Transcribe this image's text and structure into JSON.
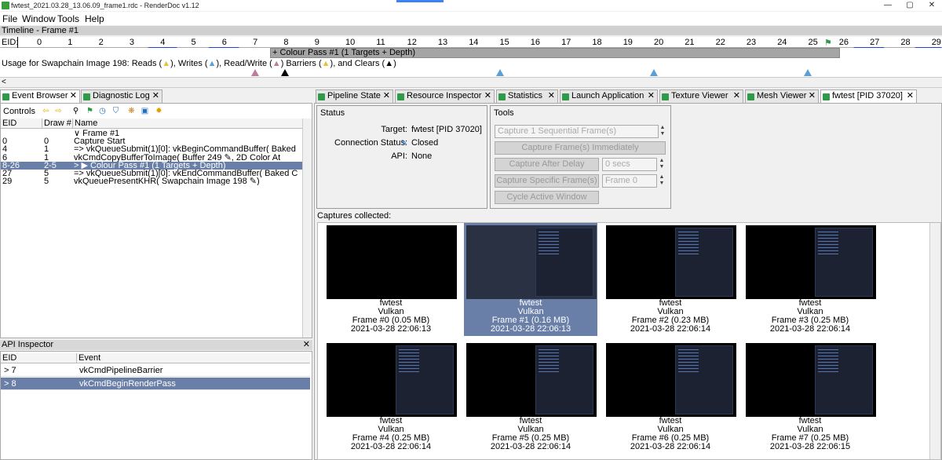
{
  "window": {
    "title": "fwtest_2021.03.28_13.06.09_frame1.rdc - RenderDoc v1.12",
    "minimize": "—",
    "maximize": "▢",
    "close": "✕"
  },
  "menu": [
    "File",
    "Window",
    "Tools",
    "Help"
  ],
  "timeline": {
    "title": "Timeline - Frame #1",
    "eid_label": "EID:",
    "ticks": [
      "0",
      "1",
      "2",
      "3",
      "4",
      "5",
      "6",
      "7",
      "8",
      "9",
      "10",
      "11",
      "12",
      "13",
      "14",
      "15",
      "16",
      "17",
      "18",
      "19",
      "20",
      "21",
      "22",
      "23",
      "24",
      "25",
      "26",
      "27",
      "28",
      "29"
    ],
    "pass_label": "+ Colour Pass #1 (1 Targets + Depth)",
    "usage_text_prefix": "Usage for Swapchain Image 198: Reads (",
    "usage_writes": "), Writes (",
    "usage_rw": "), Read/Write (",
    "usage_barriers": ") Barriers (",
    "usage_clears": "), and Clears (",
    "usage_end": ")",
    "scroll_left": "<"
  },
  "left_tabs": [
    {
      "label": "Event Browser",
      "active": true
    },
    {
      "label": "Diagnostic Log",
      "active": false
    }
  ],
  "right_tabs": [
    {
      "label": "Pipeline State",
      "active": false
    },
    {
      "label": "Resource Inspector",
      "active": false
    },
    {
      "label": "Statistics",
      "active": false
    },
    {
      "label": "Launch Application",
      "active": false
    },
    {
      "label": "Texture Viewer",
      "active": false
    },
    {
      "label": "Mesh Viewer",
      "active": false
    },
    {
      "label": "fwtest [PID 37020]",
      "active": true
    }
  ],
  "event_browser": {
    "controls_label": "Controls",
    "columns": [
      "EID",
      "Draw #",
      "Name"
    ],
    "rows": [
      {
        "eid": "",
        "draw": "",
        "name": "∨ Frame #1",
        "selected": false
      },
      {
        "eid": "0",
        "draw": "0",
        "name": "Capture Start",
        "selected": false
      },
      {
        "eid": "4",
        "draw": "1",
        "name": "=> vkQueueSubmit(1)[0]: vkBeginCommandBuffer( Baked",
        "selected": false
      },
      {
        "eid": "6",
        "draw": "1",
        "name": "vkCmdCopyBufferToImage( Buffer 249 ✎, 2D Color At",
        "selected": false
      },
      {
        "eid": "8-26",
        "draw": "2-5",
        "name": "> ▶ Colour Pass #1 (1 Targets + Depth)",
        "selected": true
      },
      {
        "eid": "27",
        "draw": "5",
        "name": "=> vkQueueSubmit(1)[0]: vkEndCommandBuffer( Baked C",
        "selected": false
      },
      {
        "eid": "29",
        "draw": "5",
        "name": "vkQueuePresentKHR( Swapchain Image 198 ✎)",
        "selected": false
      }
    ]
  },
  "api_inspector": {
    "title": "API Inspector",
    "close": "✕",
    "columns": [
      "EID",
      "Event"
    ],
    "rows": [
      {
        "eid": "> 7",
        "event": "vkCmdPipelineBarrier",
        "selected": false
      },
      {
        "eid": "> 8",
        "event": "vkCmdBeginRenderPass",
        "selected": true
      }
    ]
  },
  "status": {
    "title": "Status",
    "target_label": "Target:",
    "target_value": "fwtest [PID 37020]",
    "connection_label": "Connection Status:",
    "connection_value": "Closed",
    "api_label": "API:",
    "api_value": "None"
  },
  "tools": {
    "title": "Tools",
    "capture_sequential": "Capture 1 Sequential Frame(s)",
    "capture_immediately": "Capture Frame(s) Immediately",
    "capture_after_delay": "Capture After Delay",
    "delay_value": "0 secs",
    "capture_specific": "Capture Specific Frame(s)",
    "frame_value": "Frame 0",
    "cycle_window": "Cycle Active Window"
  },
  "captures": {
    "label": "Captures collected:",
    "items": [
      {
        "name": "fwtest",
        "api": "Vulkan",
        "frame": "Frame #0 (0.05 MB)",
        "time": "2021-03-28 22:06:13",
        "selected": false,
        "blank": true
      },
      {
        "name": "fwtest",
        "api": "Vulkan",
        "frame": "Frame #1 (0.16 MB)",
        "time": "2021-03-28 22:06:13",
        "selected": true,
        "blank": false
      },
      {
        "name": "fwtest",
        "api": "Vulkan",
        "frame": "Frame #2 (0.23 MB)",
        "time": "2021-03-28 22:06:14",
        "selected": false,
        "blank": false
      },
      {
        "name": "fwtest",
        "api": "Vulkan",
        "frame": "Frame #3 (0.25 MB)",
        "time": "2021-03-28 22:06:14",
        "selected": false,
        "blank": false
      },
      {
        "name": "fwtest",
        "api": "Vulkan",
        "frame": "Frame #4 (0.25 MB)",
        "time": "2021-03-28 22:06:14",
        "selected": false,
        "blank": false
      },
      {
        "name": "fwtest",
        "api": "Vulkan",
        "frame": "Frame #5 (0.25 MB)",
        "time": "2021-03-28 22:06:14",
        "selected": false,
        "blank": false
      },
      {
        "name": "fwtest",
        "api": "Vulkan",
        "frame": "Frame #6 (0.25 MB)",
        "time": "2021-03-28 22:06:14",
        "selected": false,
        "blank": false
      },
      {
        "name": "fwtest",
        "api": "Vulkan",
        "frame": "Frame #7 (0.25 MB)",
        "time": "2021-03-28 22:06:15",
        "selected": false,
        "blank": false
      }
    ]
  }
}
